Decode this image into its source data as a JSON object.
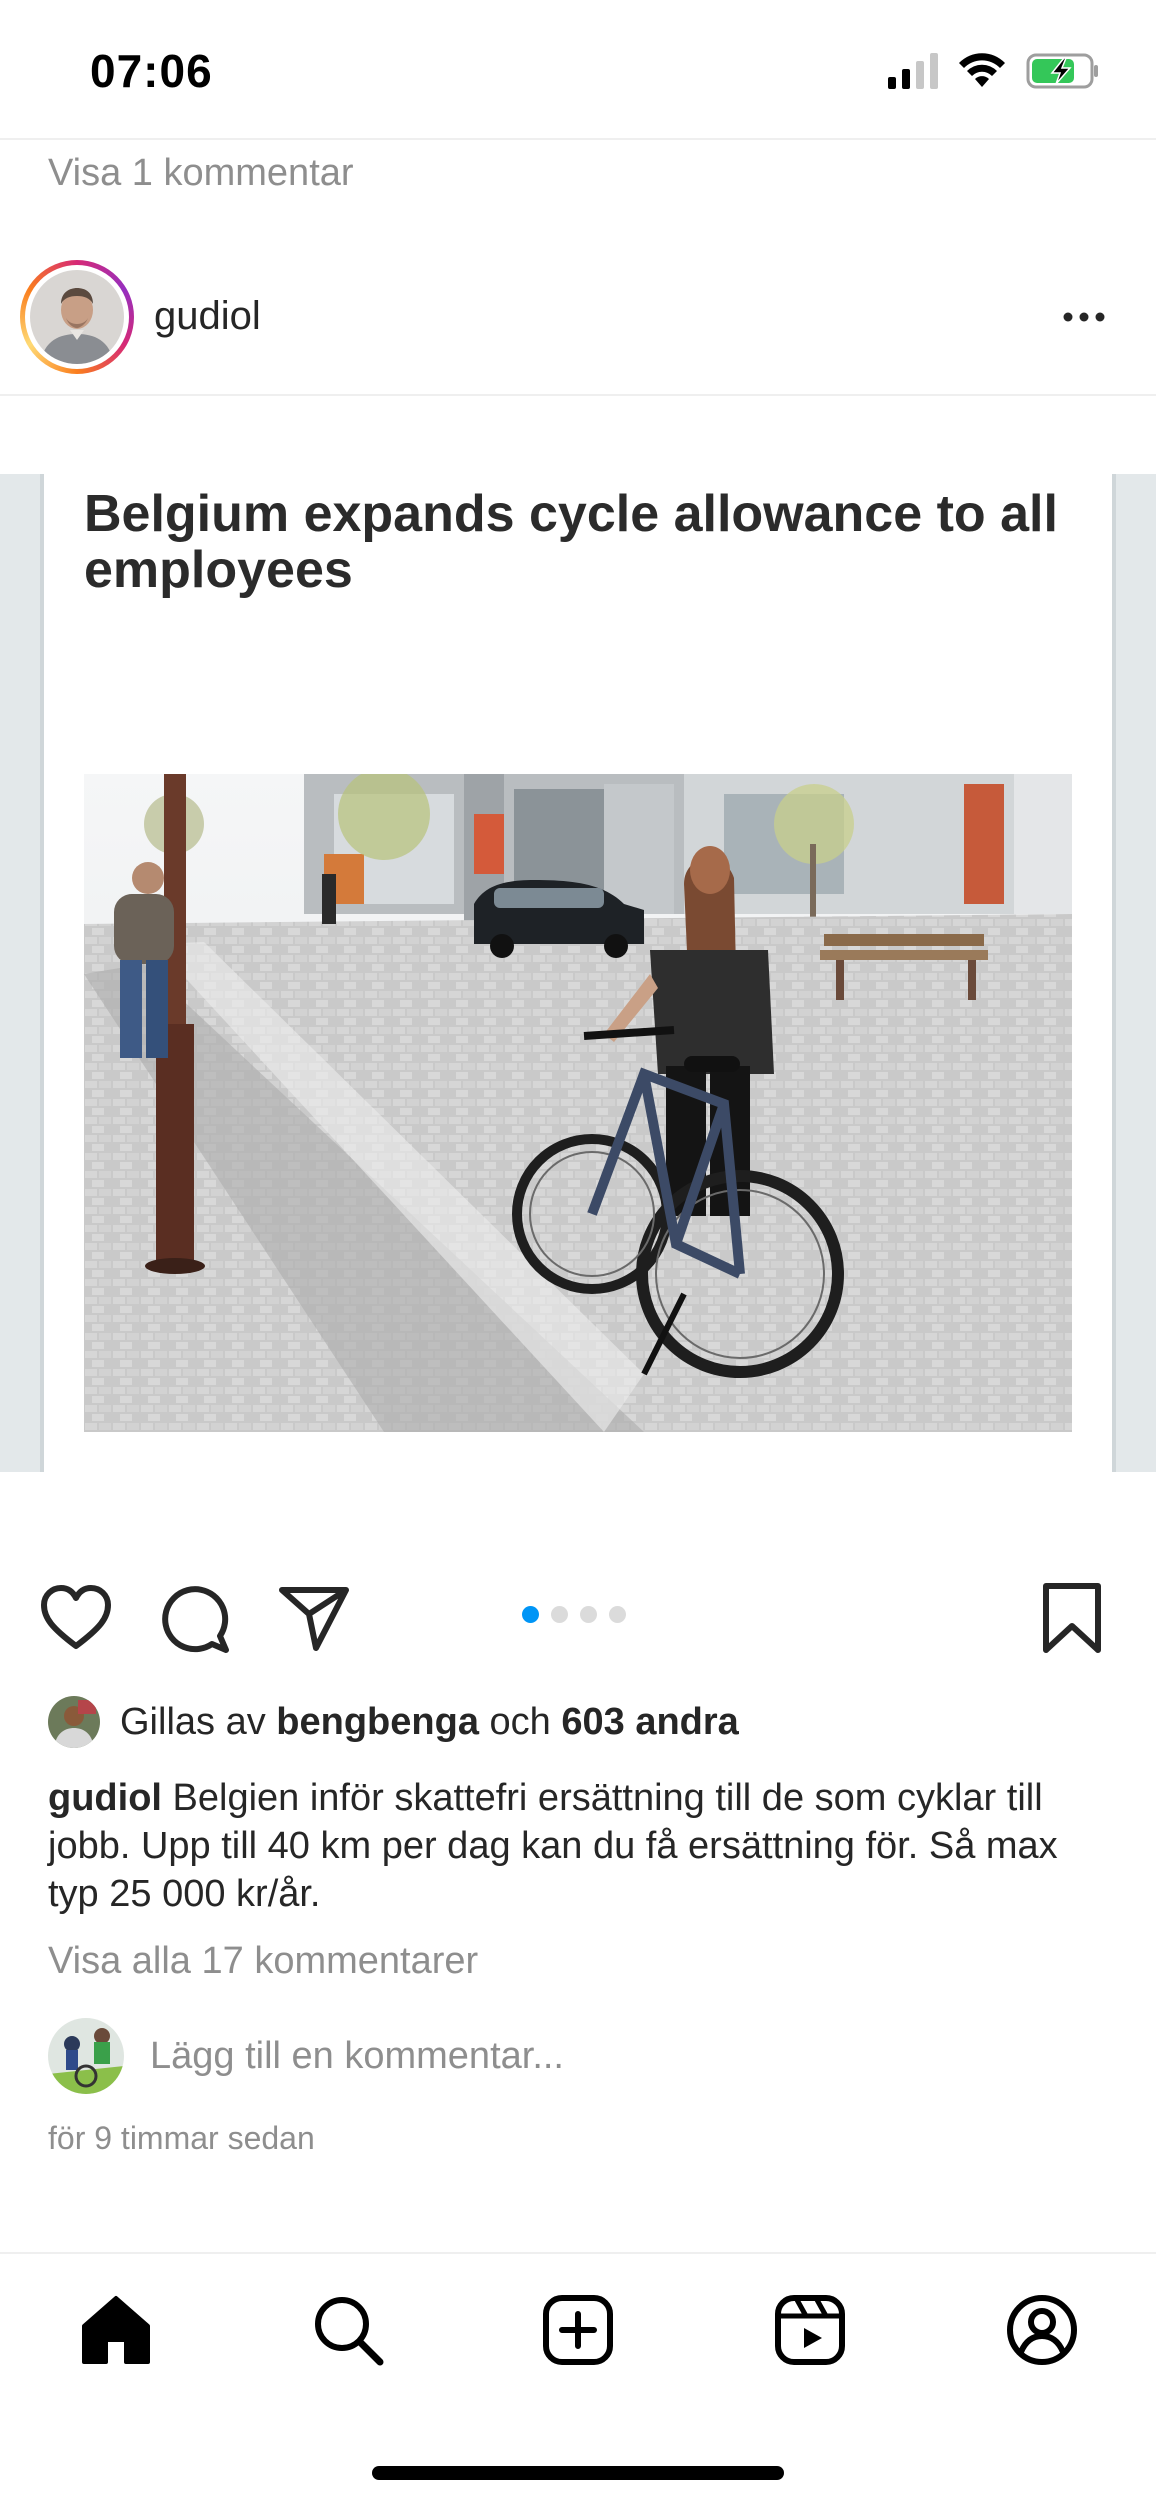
{
  "status_bar": {
    "time": "07:06",
    "icons": [
      "cellular-signal-icon",
      "wifi-icon",
      "battery-charging-icon"
    ]
  },
  "feed": {
    "previous_post_comments_link": "Visa 1 kommentar"
  },
  "post": {
    "username": "gudiol",
    "menu_icon": "more-icon",
    "media": {
      "article_title": "Belgium expands cycle allowance to all employees",
      "carousel_count": 4,
      "carousel_active_index": 1
    },
    "actions": {
      "icons": [
        "heart-icon",
        "comment-icon",
        "share-icon",
        "bookmark-icon"
      ]
    },
    "likes": {
      "prefix": "Gillas av",
      "first_liker": "bengbenga",
      "connector": "och",
      "others": "603 andra"
    },
    "caption": {
      "username": "gudiol",
      "text": "Belgien inför skattefri ersättning till de som cyklar till jobb. Upp till 40 km per dag kan du få ersättning för. Så max typ 25 000 kr/år."
    },
    "view_all_comments": "Visa alla 17 kommentarer",
    "add_comment_placeholder": "Lägg till en kommentar...",
    "timestamp": "för 9 timmar sedan"
  },
  "tab_bar": {
    "tabs": [
      "home-icon",
      "search-icon",
      "create-icon",
      "reels-icon",
      "profile-icon"
    ],
    "active": "home-icon"
  },
  "colors": {
    "accent": "#0095f6",
    "secondary_text": "#8e8e8e",
    "primary_text": "#262626"
  }
}
